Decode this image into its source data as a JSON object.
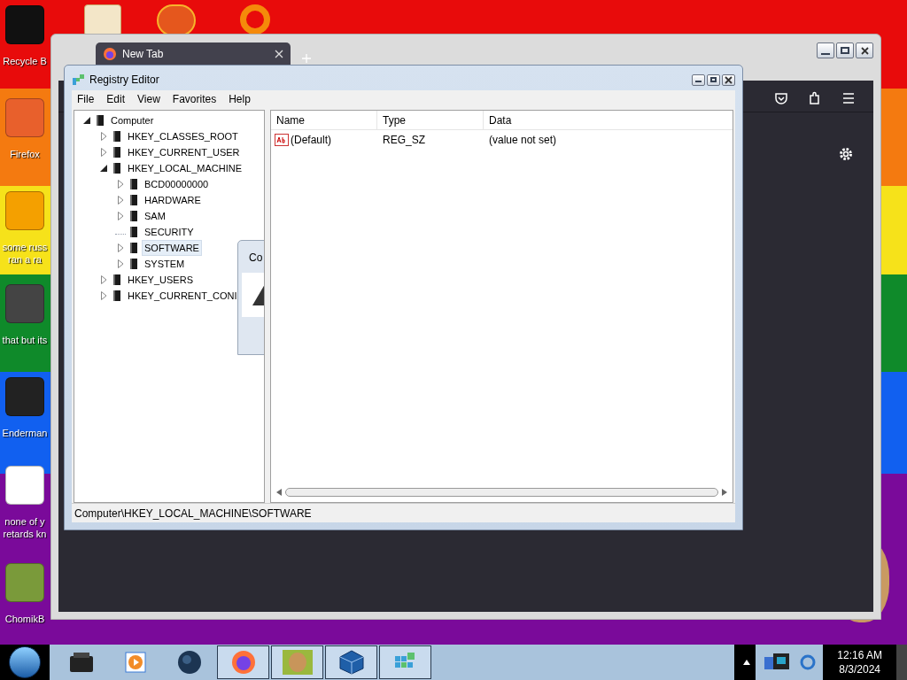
{
  "desktop_icons": [
    {
      "label": "Recycle B"
    },
    {
      "label": "Firefox"
    },
    {
      "label": "some russ ran a ra"
    },
    {
      "label": "that but its"
    },
    {
      "label": "Enderman"
    },
    {
      "label": "none of y retards kn"
    },
    {
      "label": "ChomikB"
    }
  ],
  "browser": {
    "tab_title": "New Tab"
  },
  "background_dialog": {
    "title": "Co"
  },
  "registry_editor": {
    "title": "Registry Editor",
    "menu": [
      "File",
      "Edit",
      "View",
      "Favorites",
      "Help"
    ],
    "tree": [
      {
        "label": "Computer",
        "expandable": true,
        "expanded": true,
        "selected": false,
        "children": [
          {
            "label": "HKEY_CLASSES_ROOT",
            "expandable": true,
            "expanded": false,
            "selected": false
          },
          {
            "label": "HKEY_CURRENT_USER",
            "expandable": true,
            "expanded": false,
            "selected": false
          },
          {
            "label": "HKEY_LOCAL_MACHINE",
            "expandable": true,
            "expanded": true,
            "selected": false,
            "children": [
              {
                "label": "BCD00000000",
                "expandable": true,
                "expanded": false,
                "selected": false
              },
              {
                "label": "HARDWARE",
                "expandable": true,
                "expanded": false,
                "selected": false
              },
              {
                "label": "SAM",
                "expandable": true,
                "expanded": false,
                "selected": false
              },
              {
                "label": "SECURITY",
                "expandable": false,
                "expanded": false,
                "selected": false
              },
              {
                "label": "SOFTWARE",
                "expandable": true,
                "expanded": false,
                "selected": true
              },
              {
                "label": "SYSTEM",
                "expandable": true,
                "expanded": false,
                "selected": false
              }
            ]
          },
          {
            "label": "HKEY_USERS",
            "expandable": true,
            "expanded": false,
            "selected": false
          },
          {
            "label": "HKEY_CURRENT_CONI",
            "expandable": true,
            "expanded": false,
            "selected": false
          }
        ]
      }
    ],
    "columns": [
      "Name",
      "Type",
      "Data"
    ],
    "rows": [
      {
        "name": "(Default)",
        "type": "REG_SZ",
        "data": "(value not set)"
      }
    ],
    "status_bar": "Computer\\HKEY_LOCAL_MACHINE\\SOFTWARE"
  },
  "taskbar": {
    "buttons": [
      {
        "running": false
      },
      {
        "running": false
      },
      {
        "running": false
      },
      {
        "running": true
      },
      {
        "running": true
      },
      {
        "running": true
      },
      {
        "running": true
      }
    ],
    "time": "12:16 AM",
    "date": "8/3/2024"
  }
}
